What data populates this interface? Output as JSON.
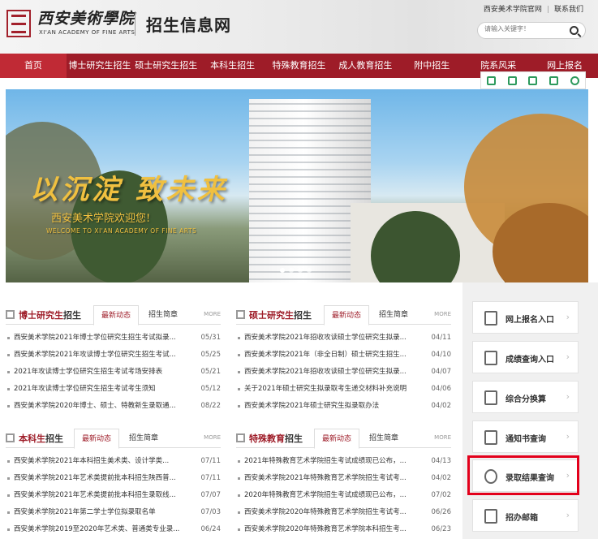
{
  "header": {
    "logo_cn": "西安美術學院",
    "logo_en": "XI'AN ACADEMY OF FINE ARTS",
    "site_name": "招生信息网",
    "top_links": [
      "西安美术学院官网",
      "联系我们"
    ],
    "search_placeholder": "请输入关键字！"
  },
  "nav": {
    "items": [
      "首页",
      "博士研究生招生",
      "硕士研究生招生",
      "本科生招生",
      "特殊教育招生",
      "成人教育招生",
      "附中招生",
      "院系风采",
      "网上报名"
    ],
    "active_index": 0
  },
  "toolbar_icons": [
    "page-icon",
    "fullscreen-icon",
    "save-icon",
    "share-icon",
    "settings-icon"
  ],
  "banner": {
    "slogan": "以沉淀 致未来",
    "welcome_cn": "西安美术学院欢迎您!",
    "welcome_en": "WELCOME TO XI'AN ACADEMY OF FINE ARTS",
    "slide_count": 4,
    "active_slide": 0
  },
  "panels": [
    {
      "title_red": "博士研究生",
      "title_rest": "招生",
      "tab_active": "最新动态",
      "tab_other": "招生简章",
      "more": "MORE",
      "items": [
        {
          "text": "西安美术学院2021年博士学位研究生招生考试拟录...",
          "date": "05/31"
        },
        {
          "text": "西安美术学院2021年攻读博士学位研究生招生考试...",
          "date": "05/25"
        },
        {
          "text": "2021年攻读博士学位研究生招生考试考场安排表",
          "date": "05/21"
        },
        {
          "text": "2021年攻读博士学位研究生招生考试考生须知",
          "date": "05/12"
        },
        {
          "text": "西安美术学院2020年博士、硕士、特教新生录取通...",
          "date": "08/22"
        }
      ]
    },
    {
      "title_red": "硕士研究生",
      "title_rest": "招生",
      "tab_active": "最新动态",
      "tab_other": "招生简章",
      "more": "MORE",
      "items": [
        {
          "text": "西安美术学院2021年招收攻读硕士学位研究生拟录...",
          "date": "04/11"
        },
        {
          "text": "西安美术学院2021年（非全日制）硕士研究生招生...",
          "date": "04/10"
        },
        {
          "text": "西安美术学院2021年招收攻读硕士学位研究生拟录...",
          "date": "04/07"
        },
        {
          "text": "关于2021年硕士研究生拟录取考生递交材料补充说明",
          "date": "04/06"
        },
        {
          "text": "西安美术学院2021年硕士研究生拟录取办法",
          "date": "04/02"
        }
      ]
    },
    {
      "title_red": "本科生",
      "title_rest": "招生",
      "tab_active": "最新动态",
      "tab_other": "招生简章",
      "more": "MORE",
      "items": [
        {
          "text": "西安美术学院2021年本科招生美术类、设计学类...",
          "date": "07/11"
        },
        {
          "text": "西安美术学院2021年艺术类提前批本科招生陕西普...",
          "date": "07/11"
        },
        {
          "text": "西安美术学院2021年艺术类提前批本科招生录取线...",
          "date": "07/07"
        },
        {
          "text": "西安美术学院2021年第二学士学位拟录取名单",
          "date": "07/03"
        },
        {
          "text": "西安美术学院2019至2020年艺术类、普通类专业录...",
          "date": "06/24"
        }
      ]
    },
    {
      "title_red": "特殊教育",
      "title_rest": "招生",
      "tab_active": "最新动态",
      "tab_other": "招生简章",
      "more": "MORE",
      "items": [
        {
          "text": "2021年特殊教育艺术学院招生考试成绩现已公布，...",
          "date": "04/13"
        },
        {
          "text": "西安美术学院2021年特殊教育艺术学院招生考试考...",
          "date": "04/02"
        },
        {
          "text": "2020年特殊教育艺术学院招生考试成绩现已公布，...",
          "date": "07/02"
        },
        {
          "text": "西安美术学院2020年特殊教育艺术学院招生考试考...",
          "date": "06/26"
        },
        {
          "text": "西安美术学院2020年特殊教育艺术学院本科招生考...",
          "date": "06/23"
        }
      ]
    }
  ],
  "sidebar": [
    {
      "label": "网上报名入口",
      "icon": "form-icon"
    },
    {
      "label": "成绩查询入口",
      "icon": "search-doc-icon"
    },
    {
      "label": "综合分换算",
      "icon": "calculator-icon"
    },
    {
      "label": "通知书查询",
      "icon": "notice-icon"
    },
    {
      "label": "录取结果查询",
      "icon": "user-search-icon"
    },
    {
      "label": "招办邮箱",
      "icon": "mail-icon"
    }
  ]
}
